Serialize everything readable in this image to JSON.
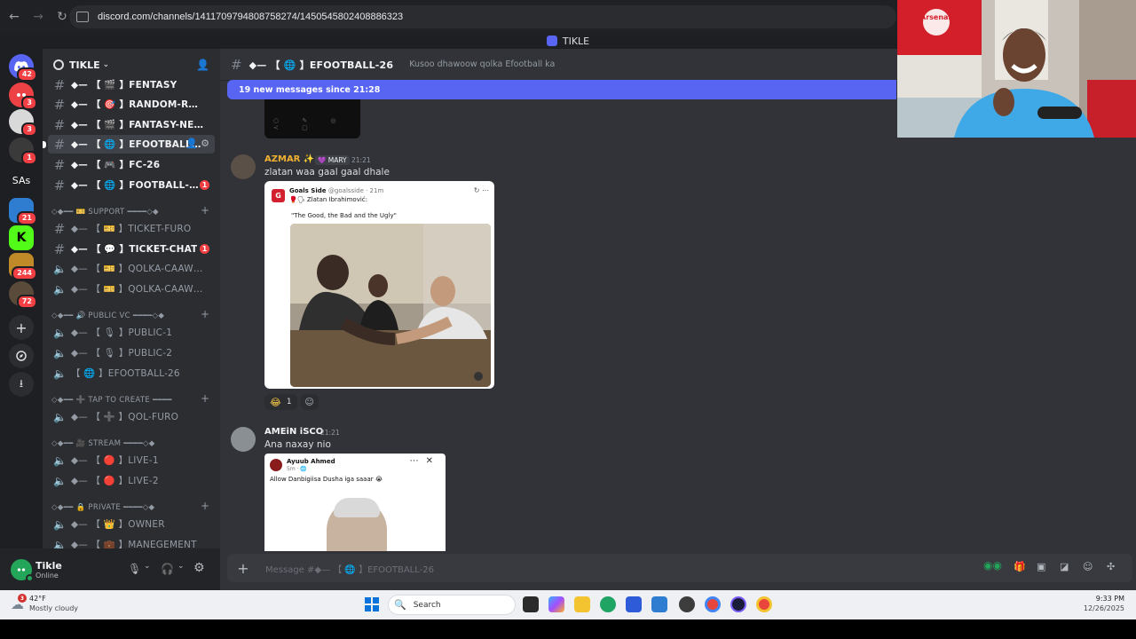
{
  "browser": {
    "url": "discord.com/channels/1411709794808758274/1450545802408886323"
  },
  "window_title": "TIKLE",
  "servers": [
    {
      "name": "discord-home",
      "badge": "42",
      "color": "#5865f2"
    },
    {
      "name": "server-2",
      "badge": "3",
      "color": "#ed4245"
    },
    {
      "name": "server-3",
      "badge": "3",
      "color": "#d9d9d9"
    },
    {
      "name": "server-4",
      "badge": "1",
      "color": "#3a3a3a"
    },
    {
      "name": "server-sas",
      "label": "SAs",
      "color": "#1e1f22"
    },
    {
      "name": "server-6",
      "badge": "21",
      "color": "#2f7dd1"
    },
    {
      "name": "server-kick",
      "label": "K",
      "color": "#53fc18"
    },
    {
      "name": "server-8",
      "badge": "244",
      "color": "#c08a28"
    },
    {
      "name": "server-9",
      "badge": "72",
      "color": "#5a4a3a"
    }
  ],
  "guild": {
    "name": "TIKLE"
  },
  "channels": {
    "fantasy": "◆— 【 🎬 】FENTASY",
    "random": "◆— 【 🎯 】RANDOM-REACTI...",
    "fantasy_news": "◆— 【 🎬 】FANTASY-NEWS",
    "efootball": "◆— 【 🌐 】EFOOTBALL-26",
    "fc26": "◆— 【 🎮 】FC-26",
    "football_news": "◆— 【 🌐 】FOOTBALL-NEWS",
    "football_news_badge": "1",
    "cat_support": "◇◆━━ 🎫 SUPPORT ━━━━◇◆",
    "ticket_furo": "◆— 【 🎫 】TICKET-FURO",
    "ticket_chat": "◆— 【 💬 】TICKET-CHAT",
    "ticket_chat_badge": "1",
    "qolka1": "◆— 【 🎫 】QOLKA-CAAWINT...",
    "qolka2": "◆— 【 🎫 】QOLKA-CAAWINT...",
    "cat_public_vc": "◇◆━━ 🔊 PUBLIC VC ━━━━◇◆",
    "public1": "◆— 【 🎙 】PUBLIC-1",
    "public2": "◆— 【 🎙 】PUBLIC-2",
    "efootball_voice": "【 🌐 】EFOOTBALL-26",
    "cat_tap_create": "◇◆━━ ➕ TAP TO CREATE ━━━━",
    "qol_furo": "◆— 【 ➕ 】QOL-FURO",
    "cat_stream": "◇◆━━ 🎥 STREAM ━━━━◇◆",
    "live1": "◆— 【 🔴 】LIVE-1",
    "live2": "◆— 【 🔴 】LIVE-2",
    "cat_private": "◇◆━━ 🔒 PRIVATE ━━━━◇◆",
    "owner": "◆— 【 👑 】OWNER",
    "management": "◆— 【 💼 】MANEGEMENT"
  },
  "user": {
    "name": "Tikle",
    "status": "Online"
  },
  "chat": {
    "header_name": "◆— 【 🌐 】EFOOTBALL-26",
    "topic": "Kusoo dhawoow qolka Efootball ka",
    "new_messages": "19 new messages since 21:28",
    "composer_placeholder": "Message #◆— 【 🌐 】EFOOTBALL-26"
  },
  "messages": [
    {
      "author": "AZMAR ✨",
      "author_color": "#f0b132",
      "role_tag": "💜 MARY",
      "time": "21:21",
      "text": "zlatan waa gaal gaal dhale",
      "embed": {
        "account": "Goals Side",
        "handle": "@goalsside · 21m",
        "subtitle": "🥊🗣 Zlatan Ibrahimović:",
        "quote": "\"The Good, the Bad and the Ugly\""
      },
      "reaction_emoji": "😂",
      "reaction_count": "1"
    },
    {
      "author": "AMEiN iSCO",
      "author_color": "#f2f3f5",
      "time": "21:21",
      "text": "Ana naxay nio",
      "embed": {
        "name": "Ayuub Ahmed",
        "meta": "5m · 🌐",
        "text": "Allow Danbigiisa Dusha iga saaar 😭"
      }
    }
  ],
  "webcam": {
    "flag_text": "Arsenal"
  },
  "taskbar": {
    "weather_badge": "3",
    "temp": "42°F",
    "condition": "Mostly cloudy",
    "search": "Search",
    "time": "9:33 PM",
    "date": "12/26/2025"
  }
}
